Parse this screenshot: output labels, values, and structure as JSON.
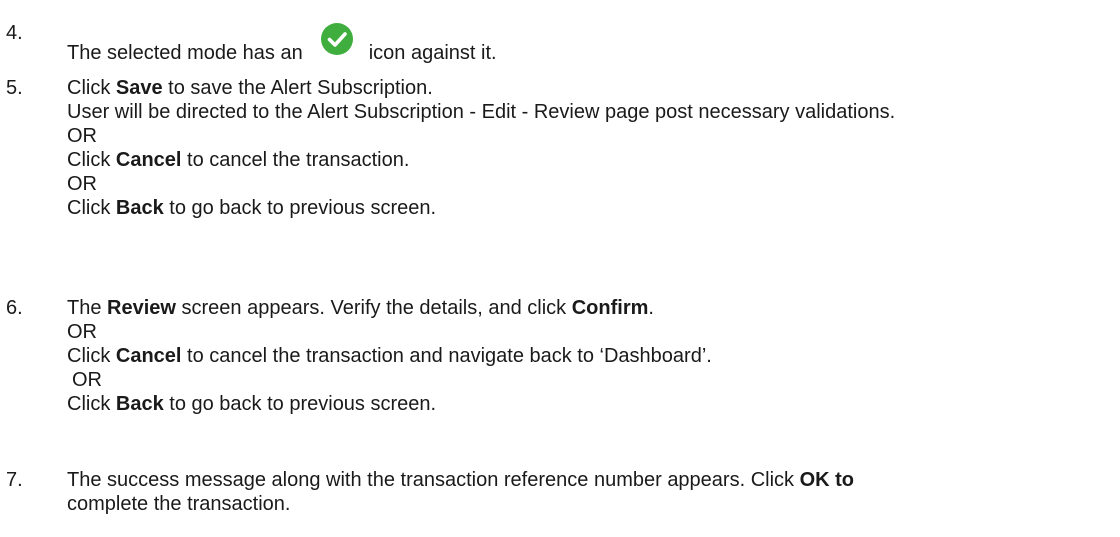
{
  "step4": {
    "number": "4.",
    "text_before": "The selected mode has an",
    "text_after": "icon against it.",
    "icon": "check-circle-icon",
    "icon_color": "#3fae3f"
  },
  "step5": {
    "number": "5.",
    "l1_a": "Click ",
    "l1_b": "Save",
    "l1_c": " to save the Alert Subscription.",
    "l2": "User will be directed to the Alert Subscription - Edit - Review page post necessary validations.",
    "or1": "OR",
    "l4_a": "Click ",
    "l4_b": "Cancel",
    "l4_c": " to cancel the transaction.",
    "or2": "OR",
    "l6_a": "Click ",
    "l6_b": "Back",
    "l6_c": " to go back to previous screen."
  },
  "step6": {
    "number": "6.",
    "l1_a": "The ",
    "l1_b": "Review",
    "l1_c": " screen appears. Verify the details, and click ",
    "l1_d": "Confirm",
    "l1_e": ".",
    "or1": "OR",
    "l3_a": "Click ",
    "l3_b": "Cancel",
    "l3_c": " to cancel the transaction and navigate back to ‘Dashboard’.",
    "or2": "OR",
    "l5_a": "Click ",
    "l5_b": "Back",
    "l5_c": " to go back to previous screen."
  },
  "step7": {
    "number": "7.",
    "l1_a": "The success message along with the transaction reference number appears. Click ",
    "l1_b": "OK to",
    "l2": "complete the transaction."
  }
}
